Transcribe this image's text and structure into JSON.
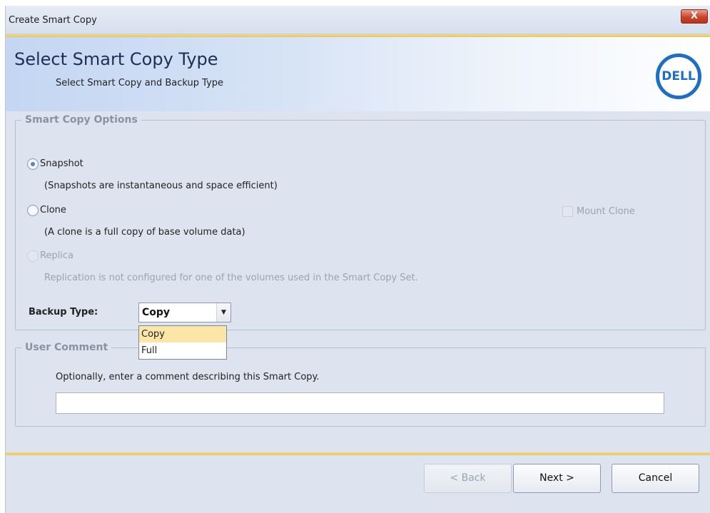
{
  "window": {
    "title": "Create Smart Copy",
    "close_label": "X"
  },
  "header": {
    "title": "Select Smart Copy Type",
    "subtitle": "Select Smart Copy and Backup Type",
    "logo_text": "DELL"
  },
  "options": {
    "legend": "Smart Copy Options",
    "snapshot_label": "Snapshot",
    "snapshot_desc": "(Snapshots are instantaneous and space efficient)",
    "clone_label": "Clone",
    "clone_desc": "(A clone is a full copy of base volume data)",
    "mount_clone_label": "Mount Clone",
    "replica_label": "Replica",
    "replica_desc": "Replication is not configured for one of the volumes used in the Smart Copy Set.",
    "selected": "Snapshot"
  },
  "backup": {
    "label": "Backup Type:",
    "value": "Copy",
    "options": [
      "Copy",
      "Full"
    ],
    "highlighted": "Copy"
  },
  "comment": {
    "legend": "User Comment",
    "instruction": "Optionally, enter a comment describing this Smart Copy.",
    "value": ""
  },
  "buttons": {
    "back": "< Back",
    "next": "Next >",
    "cancel": "Cancel"
  },
  "colors": {
    "accent": "#e9c65e",
    "brand": "#1d6fc5",
    "highlight": "#fbe6a8"
  }
}
